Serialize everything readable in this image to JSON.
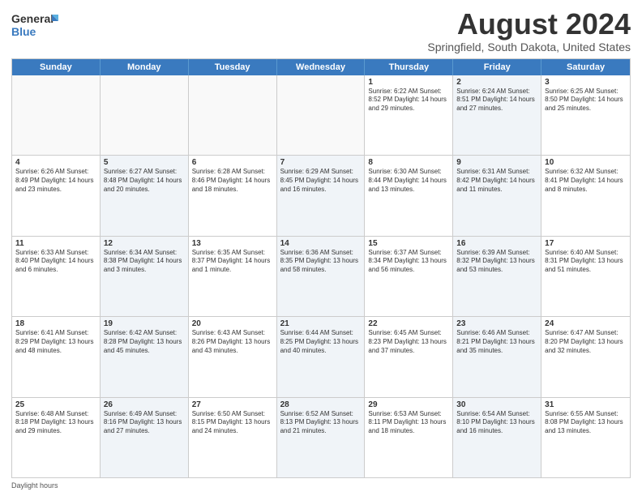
{
  "logo": {
    "general": "General",
    "blue": "Blue"
  },
  "title": "August 2024",
  "subtitle": "Springfield, South Dakota, United States",
  "days_of_week": [
    "Sunday",
    "Monday",
    "Tuesday",
    "Wednesday",
    "Thursday",
    "Friday",
    "Saturday"
  ],
  "weeks": [
    [
      {
        "day": "",
        "info": "",
        "shaded": false,
        "empty": true
      },
      {
        "day": "",
        "info": "",
        "shaded": false,
        "empty": true
      },
      {
        "day": "",
        "info": "",
        "shaded": false,
        "empty": true
      },
      {
        "day": "",
        "info": "",
        "shaded": false,
        "empty": true
      },
      {
        "day": "1",
        "info": "Sunrise: 6:22 AM\nSunset: 8:52 PM\nDaylight: 14 hours\nand 29 minutes.",
        "shaded": false,
        "empty": false
      },
      {
        "day": "2",
        "info": "Sunrise: 6:24 AM\nSunset: 8:51 PM\nDaylight: 14 hours\nand 27 minutes.",
        "shaded": true,
        "empty": false
      },
      {
        "day": "3",
        "info": "Sunrise: 6:25 AM\nSunset: 8:50 PM\nDaylight: 14 hours\nand 25 minutes.",
        "shaded": false,
        "empty": false
      }
    ],
    [
      {
        "day": "4",
        "info": "Sunrise: 6:26 AM\nSunset: 8:49 PM\nDaylight: 14 hours\nand 23 minutes.",
        "shaded": false,
        "empty": false
      },
      {
        "day": "5",
        "info": "Sunrise: 6:27 AM\nSunset: 8:48 PM\nDaylight: 14 hours\nand 20 minutes.",
        "shaded": true,
        "empty": false
      },
      {
        "day": "6",
        "info": "Sunrise: 6:28 AM\nSunset: 8:46 PM\nDaylight: 14 hours\nand 18 minutes.",
        "shaded": false,
        "empty": false
      },
      {
        "day": "7",
        "info": "Sunrise: 6:29 AM\nSunset: 8:45 PM\nDaylight: 14 hours\nand 16 minutes.",
        "shaded": true,
        "empty": false
      },
      {
        "day": "8",
        "info": "Sunrise: 6:30 AM\nSunset: 8:44 PM\nDaylight: 14 hours\nand 13 minutes.",
        "shaded": false,
        "empty": false
      },
      {
        "day": "9",
        "info": "Sunrise: 6:31 AM\nSunset: 8:42 PM\nDaylight: 14 hours\nand 11 minutes.",
        "shaded": true,
        "empty": false
      },
      {
        "day": "10",
        "info": "Sunrise: 6:32 AM\nSunset: 8:41 PM\nDaylight: 14 hours\nand 8 minutes.",
        "shaded": false,
        "empty": false
      }
    ],
    [
      {
        "day": "11",
        "info": "Sunrise: 6:33 AM\nSunset: 8:40 PM\nDaylight: 14 hours\nand 6 minutes.",
        "shaded": false,
        "empty": false
      },
      {
        "day": "12",
        "info": "Sunrise: 6:34 AM\nSunset: 8:38 PM\nDaylight: 14 hours\nand 3 minutes.",
        "shaded": true,
        "empty": false
      },
      {
        "day": "13",
        "info": "Sunrise: 6:35 AM\nSunset: 8:37 PM\nDaylight: 14 hours\nand 1 minute.",
        "shaded": false,
        "empty": false
      },
      {
        "day": "14",
        "info": "Sunrise: 6:36 AM\nSunset: 8:35 PM\nDaylight: 13 hours\nand 58 minutes.",
        "shaded": true,
        "empty": false
      },
      {
        "day": "15",
        "info": "Sunrise: 6:37 AM\nSunset: 8:34 PM\nDaylight: 13 hours\nand 56 minutes.",
        "shaded": false,
        "empty": false
      },
      {
        "day": "16",
        "info": "Sunrise: 6:39 AM\nSunset: 8:32 PM\nDaylight: 13 hours\nand 53 minutes.",
        "shaded": true,
        "empty": false
      },
      {
        "day": "17",
        "info": "Sunrise: 6:40 AM\nSunset: 8:31 PM\nDaylight: 13 hours\nand 51 minutes.",
        "shaded": false,
        "empty": false
      }
    ],
    [
      {
        "day": "18",
        "info": "Sunrise: 6:41 AM\nSunset: 8:29 PM\nDaylight: 13 hours\nand 48 minutes.",
        "shaded": false,
        "empty": false
      },
      {
        "day": "19",
        "info": "Sunrise: 6:42 AM\nSunset: 8:28 PM\nDaylight: 13 hours\nand 45 minutes.",
        "shaded": true,
        "empty": false
      },
      {
        "day": "20",
        "info": "Sunrise: 6:43 AM\nSunset: 8:26 PM\nDaylight: 13 hours\nand 43 minutes.",
        "shaded": false,
        "empty": false
      },
      {
        "day": "21",
        "info": "Sunrise: 6:44 AM\nSunset: 8:25 PM\nDaylight: 13 hours\nand 40 minutes.",
        "shaded": true,
        "empty": false
      },
      {
        "day": "22",
        "info": "Sunrise: 6:45 AM\nSunset: 8:23 PM\nDaylight: 13 hours\nand 37 minutes.",
        "shaded": false,
        "empty": false
      },
      {
        "day": "23",
        "info": "Sunrise: 6:46 AM\nSunset: 8:21 PM\nDaylight: 13 hours\nand 35 minutes.",
        "shaded": true,
        "empty": false
      },
      {
        "day": "24",
        "info": "Sunrise: 6:47 AM\nSunset: 8:20 PM\nDaylight: 13 hours\nand 32 minutes.",
        "shaded": false,
        "empty": false
      }
    ],
    [
      {
        "day": "25",
        "info": "Sunrise: 6:48 AM\nSunset: 8:18 PM\nDaylight: 13 hours\nand 29 minutes.",
        "shaded": false,
        "empty": false
      },
      {
        "day": "26",
        "info": "Sunrise: 6:49 AM\nSunset: 8:16 PM\nDaylight: 13 hours\nand 27 minutes.",
        "shaded": true,
        "empty": false
      },
      {
        "day": "27",
        "info": "Sunrise: 6:50 AM\nSunset: 8:15 PM\nDaylight: 13 hours\nand 24 minutes.",
        "shaded": false,
        "empty": false
      },
      {
        "day": "28",
        "info": "Sunrise: 6:52 AM\nSunset: 8:13 PM\nDaylight: 13 hours\nand 21 minutes.",
        "shaded": true,
        "empty": false
      },
      {
        "day": "29",
        "info": "Sunrise: 6:53 AM\nSunset: 8:11 PM\nDaylight: 13 hours\nand 18 minutes.",
        "shaded": false,
        "empty": false
      },
      {
        "day": "30",
        "info": "Sunrise: 6:54 AM\nSunset: 8:10 PM\nDaylight: 13 hours\nand 16 minutes.",
        "shaded": true,
        "empty": false
      },
      {
        "day": "31",
        "info": "Sunrise: 6:55 AM\nSunset: 8:08 PM\nDaylight: 13 hours\nand 13 minutes.",
        "shaded": false,
        "empty": false
      }
    ]
  ],
  "footer": "Daylight hours"
}
